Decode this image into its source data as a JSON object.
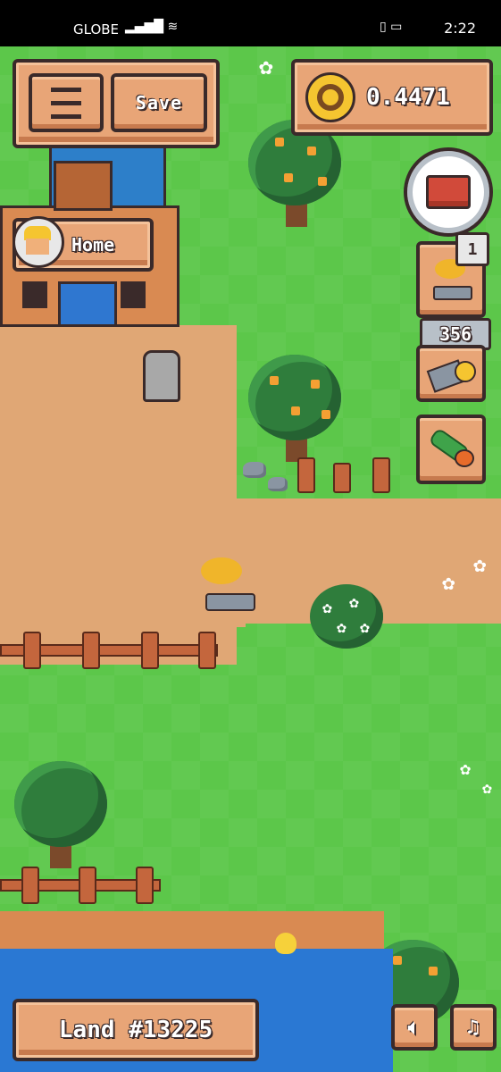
{
  "status_bar": {
    "carrier": "GLOBE",
    "time": "2:22"
  },
  "hud": {
    "save_label": "Save",
    "balance": "0.4471",
    "home_label": "Home",
    "land_label": "Land #13225",
    "inventory_badge": "1",
    "seed_count": "356"
  },
  "colors": {
    "grass": "#5cc74a",
    "dirt": "#e0a775",
    "panel": "#e8a577",
    "panel_border": "#3a2a2a",
    "water": "#2a78d3"
  },
  "icons": [
    "menu-icon",
    "sunflower-coin-icon",
    "toolbox-icon",
    "bonsai-icon",
    "seed-bag-icon",
    "cucumber-icon",
    "sound-icon",
    "music-icon"
  ]
}
